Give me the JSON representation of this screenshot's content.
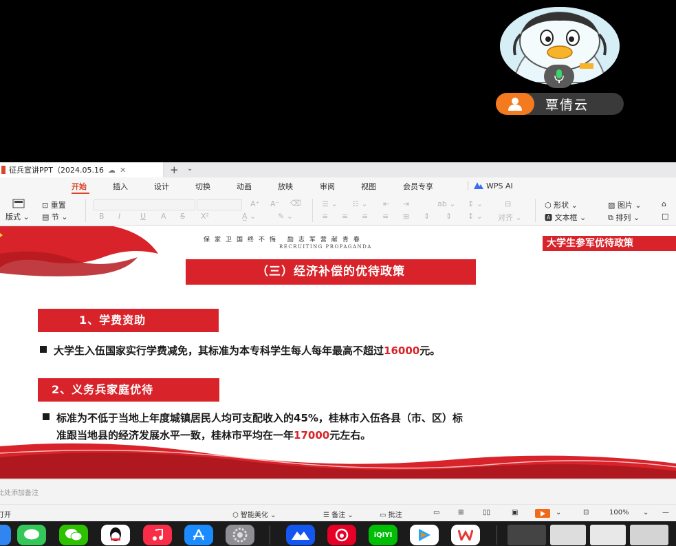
{
  "video_call": {
    "participant_name": "覃倩云"
  },
  "window": {
    "tab_title": "征兵宣讲PPT（2024.05.16",
    "new_tab_symbol": "+"
  },
  "menu": {
    "items": [
      "开始",
      "插入",
      "设计",
      "切换",
      "动画",
      "放映",
      "审阅",
      "视图",
      "会员专享"
    ],
    "active": "开始",
    "wps_ai": "WPS AI"
  },
  "ribbon": {
    "layout_label": "版式",
    "reset_label": "重置",
    "section_label": "节",
    "bold": "B",
    "italic": "I",
    "underline": "U",
    "strike_a": "A",
    "strike_s": "S",
    "superscript": "X²",
    "align_label": "对齐",
    "shape_label": "形状",
    "picture_label": "图片",
    "textbox_label": "文本框",
    "arrange_label": "排列"
  },
  "slide": {
    "slogan_cn": "保家卫国终不悔  励志军营献青春",
    "slogan_en": "RECRUITING PROPAGANDA",
    "corner_title": "大学生参军优待政策",
    "main_title": "（三）经济补偿的优待政策",
    "section1": {
      "heading": "1、学费资助",
      "text_before": "大学生入伍国家实行学费减免，其标准为本专科学生每人每年最高不超过",
      "highlight": "16000",
      "text_after": "元。"
    },
    "section2": {
      "heading": "2、义务兵家庭优待",
      "line1": "标准为不低于当地上年度城镇居民人均可支配收入的45%，桂林市入伍各县（市、区）标",
      "line2_before": "准跟当地县的经济发展水平一致，桂林市平均在一年",
      "highlight": "17000",
      "line2_after": "元左右。"
    }
  },
  "notes": {
    "placeholder": "此处添加备注"
  },
  "status": {
    "left_text": "打开",
    "smart_beautify": "智能美化",
    "notes_label": "备注",
    "comments_label": "批注",
    "zoom": "100%"
  },
  "dock": {
    "apps": [
      "finder",
      "messages",
      "wechat",
      "qq",
      "music",
      "app-store",
      "settings",
      "lark",
      "netease-music",
      "iqiyi",
      "tencent-video",
      "wps-office"
    ],
    "iqiyi_label": "iQIYI"
  },
  "colors": {
    "brand_red": "#d8232a",
    "wps_orange": "#d9472b",
    "dock_bg": "#1b1b1b"
  }
}
